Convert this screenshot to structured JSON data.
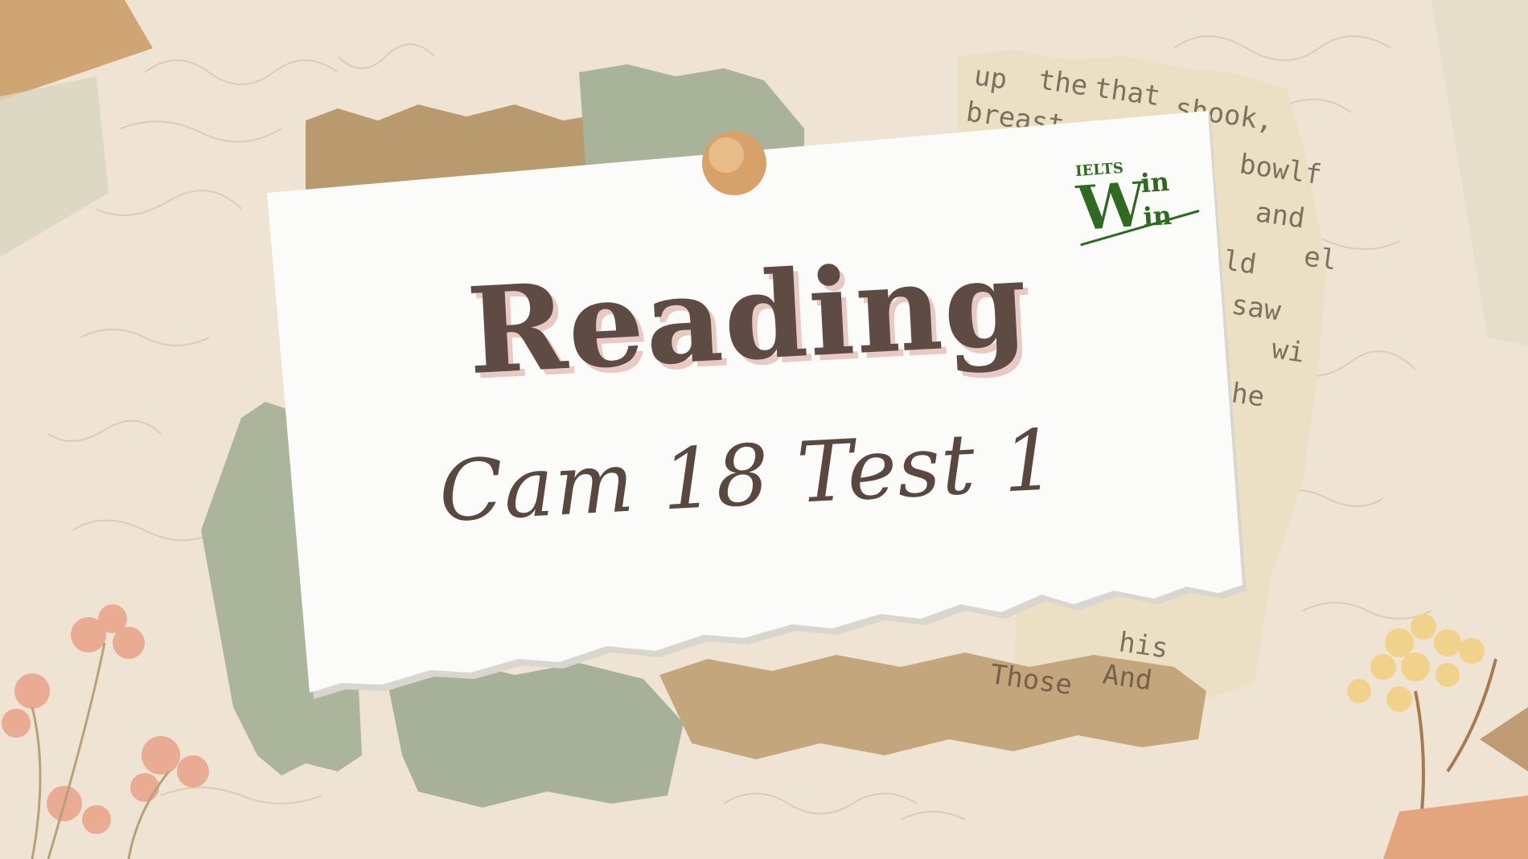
{
  "card": {
    "title": "Reading",
    "subtitle": "Cam 18 Test 1"
  },
  "logo": {
    "small_text": "IELTS",
    "big_letter": "W",
    "word_top": "in",
    "word_bottom": "in"
  },
  "newspaper_words": [
    "up",
    "the",
    "that",
    "shook,",
    "breast",
    "bowlf",
    "and",
    "ld",
    "el",
    "saw",
    "wi",
    "he",
    "his",
    "Those",
    "And"
  ],
  "colors": {
    "background": "#efe3d3",
    "paper": "#fbfbfa",
    "title": "#5e4b44",
    "title_shadow": "#e9c9c3",
    "logo_green": "#2e6a1f",
    "pin": "#d9a46a",
    "sage": "#a9b39a",
    "kraft": "#b99a6e"
  }
}
